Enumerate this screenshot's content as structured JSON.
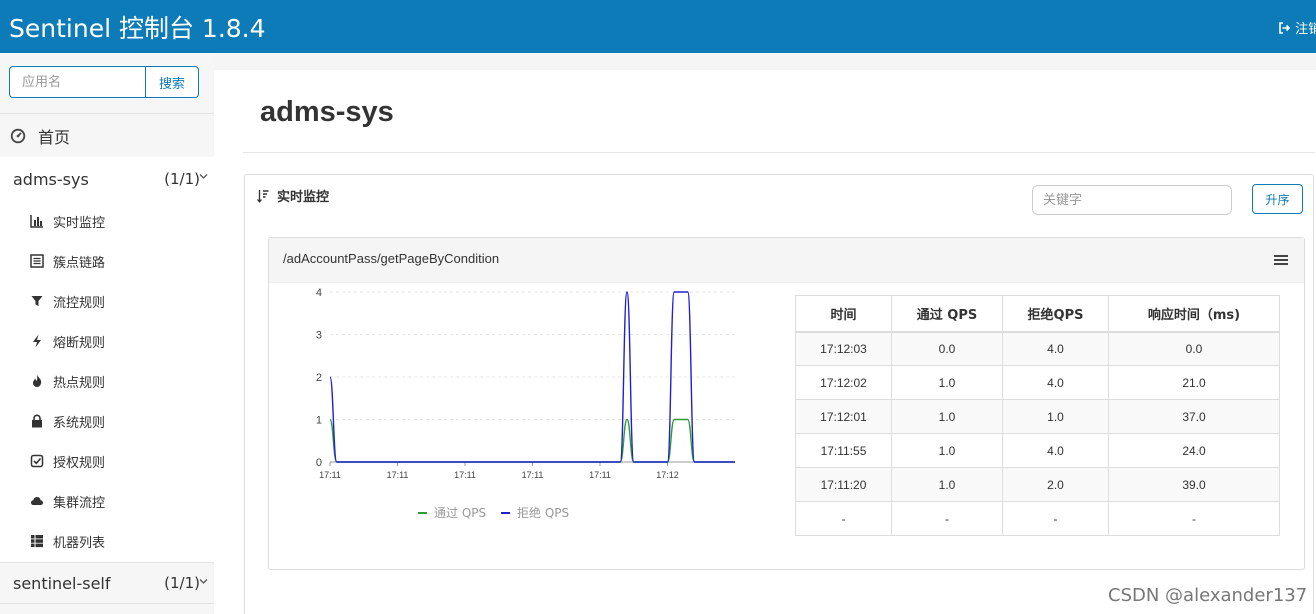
{
  "header": {
    "brand": "Sentinel 控制台 1.8.4",
    "logout_label": "注销",
    "logout_icon": "logout-icon",
    "bg_color": "#0c7bb8"
  },
  "sidebar": {
    "search": {
      "placeholder": "应用名",
      "button_label": "搜索"
    },
    "home": {
      "label": "首页",
      "icon": "dashboard-icon"
    },
    "apps": [
      {
        "name": "adms-sys",
        "count": "(1/1)",
        "items": [
          {
            "label": "实时监控",
            "icon": "bar-chart-icon"
          },
          {
            "label": "簇点链路",
            "icon": "list-icon"
          },
          {
            "label": "流控规则",
            "icon": "filter-icon"
          },
          {
            "label": "熔断规则",
            "icon": "flash-icon"
          },
          {
            "label": "热点规则",
            "icon": "fire-icon"
          },
          {
            "label": "系统规则",
            "icon": "lock-icon"
          },
          {
            "label": "授权规则",
            "icon": "check-square-icon"
          },
          {
            "label": "集群流控",
            "icon": "cloud-icon"
          },
          {
            "label": "机器列表",
            "icon": "th-list-icon"
          }
        ]
      },
      {
        "name": "sentinel-self",
        "count": "(1/1)"
      }
    ]
  },
  "main": {
    "title": "adms-sys",
    "panel": {
      "title": "实时监控",
      "keyword_placeholder": "关键字",
      "sort_button": "升序"
    },
    "resource": {
      "name": "/adAccountPass/getPageByCondition",
      "table": {
        "headers": [
          "时间",
          "通过 QPS",
          "拒绝QPS",
          "响应时间（ms)"
        ],
        "rows": [
          [
            "17:12:03",
            "0.0",
            "4.0",
            "0.0"
          ],
          [
            "17:12:02",
            "1.0",
            "4.0",
            "21.0"
          ],
          [
            "17:12:01",
            "1.0",
            "1.0",
            "37.0"
          ],
          [
            "17:11:55",
            "1.0",
            "4.0",
            "24.0"
          ],
          [
            "17:11:20",
            "1.0",
            "2.0",
            "39.0"
          ],
          [
            "-",
            "-",
            "-",
            "-"
          ]
        ]
      }
    }
  },
  "chart_data": {
    "type": "line",
    "x": [
      0,
      1,
      2,
      3,
      4,
      5,
      6,
      7,
      8,
      9,
      10,
      11,
      12,
      13,
      14,
      15,
      16,
      17,
      18,
      19,
      20,
      21,
      22,
      23,
      24,
      25,
      26,
      27,
      28,
      29,
      30,
      31,
      32,
      33,
      34,
      35,
      36,
      37,
      38,
      39,
      40,
      41,
      42,
      43,
      44,
      45,
      46,
      47,
      48,
      49,
      50,
      51,
      52,
      53,
      54,
      55,
      56,
      57,
      58,
      59,
      60
    ],
    "x_tick_labels": [
      "17:11",
      "17:11",
      "17:11",
      "17:11",
      "17:11",
      "17:12"
    ],
    "x_tick_positions": [
      0,
      10,
      20,
      30,
      40,
      50
    ],
    "ylim": [
      0,
      4
    ],
    "y_ticks": [
      0,
      1,
      2,
      3,
      4
    ],
    "series": [
      {
        "name": "通过 QPS",
        "color": "#2e9e2e",
        "values": [
          1,
          0,
          0,
          0,
          0,
          0,
          0,
          0,
          0,
          0,
          0,
          0,
          0,
          0,
          0,
          0,
          0,
          0,
          0,
          0,
          0,
          0,
          0,
          0,
          0,
          0,
          0,
          0,
          0,
          0,
          0,
          0,
          0,
          0,
          0,
          0,
          0,
          0,
          0,
          0,
          0,
          0,
          0,
          0,
          1,
          0,
          0,
          0,
          0,
          0,
          0,
          1,
          1,
          1,
          0,
          0,
          0,
          0,
          0,
          0,
          0
        ]
      },
      {
        "name": "拒绝 QPS",
        "color": "#2020d0",
        "values": [
          2,
          0,
          0,
          0,
          0,
          0,
          0,
          0,
          0,
          0,
          0,
          0,
          0,
          0,
          0,
          0,
          0,
          0,
          0,
          0,
          0,
          0,
          0,
          0,
          0,
          0,
          0,
          0,
          0,
          0,
          0,
          0,
          0,
          0,
          0,
          0,
          0,
          0,
          0,
          0,
          0,
          0,
          0,
          0,
          4,
          0,
          0,
          0,
          0,
          0,
          0,
          4,
          4,
          4,
          0,
          0,
          0,
          0,
          0,
          0,
          0
        ]
      }
    ],
    "legend_position": "bottom",
    "grid": true
  },
  "watermark": "CSDN @alexander137"
}
